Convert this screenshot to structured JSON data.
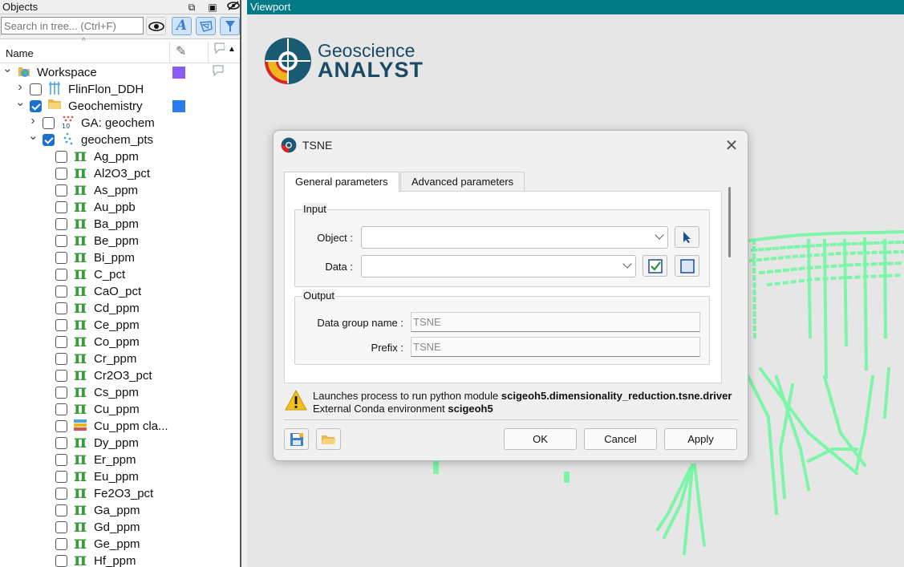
{
  "objects_panel": {
    "title": "Objects",
    "search_placeholder": "Search in tree... (Ctrl+F)",
    "column_name": "Name",
    "tree": [
      {
        "label": "Workspace",
        "level": 0,
        "expanded": true,
        "checkbox": false,
        "icon": "workspace-icon",
        "swatch": "#8a5cf6"
      },
      {
        "label": "FlinFlon_DDH",
        "level": 1,
        "expanded": false,
        "checkbox": true,
        "checked": false,
        "icon": "drillhole-icon"
      },
      {
        "label": "Geochemistry",
        "level": 1,
        "expanded": true,
        "checkbox": true,
        "checked": true,
        "icon": "folder-icon",
        "swatch": "#2b7bf0"
      },
      {
        "label": "GA: geochem",
        "level": 2,
        "expanded": false,
        "checkbox": true,
        "checked": false,
        "icon": "geochem-icon"
      },
      {
        "label": "geochem_pts",
        "level": 2,
        "expanded": true,
        "checkbox": true,
        "checked": true,
        "icon": "points-icon"
      },
      {
        "label": "Ag_ppm",
        "level": 3,
        "icon": "pi-icon"
      },
      {
        "label": "Al2O3_pct",
        "level": 3,
        "icon": "pi-icon"
      },
      {
        "label": "As_ppm",
        "level": 3,
        "icon": "pi-icon"
      },
      {
        "label": "Au_ppb",
        "level": 3,
        "icon": "pi-icon"
      },
      {
        "label": "Ba_ppm",
        "level": 3,
        "icon": "pi-icon"
      },
      {
        "label": "Be_ppm",
        "level": 3,
        "icon": "pi-icon"
      },
      {
        "label": "Bi_ppm",
        "level": 3,
        "icon": "pi-icon"
      },
      {
        "label": "C_pct",
        "level": 3,
        "icon": "pi-icon"
      },
      {
        "label": "CaO_pct",
        "level": 3,
        "icon": "pi-icon"
      },
      {
        "label": "Cd_ppm",
        "level": 3,
        "icon": "pi-icon"
      },
      {
        "label": "Ce_ppm",
        "level": 3,
        "icon": "pi-icon"
      },
      {
        "label": "Co_ppm",
        "level": 3,
        "icon": "pi-icon"
      },
      {
        "label": "Cr_ppm",
        "level": 3,
        "icon": "pi-icon"
      },
      {
        "label": "Cr2O3_pct",
        "level": 3,
        "icon": "pi-icon"
      },
      {
        "label": "Cs_ppm",
        "level": 3,
        "icon": "pi-icon"
      },
      {
        "label": "Cu_ppm",
        "level": 3,
        "icon": "pi-icon"
      },
      {
        "label": "Cu_ppm cla...",
        "level": 3,
        "icon": "classification-icon"
      },
      {
        "label": "Dy_ppm",
        "level": 3,
        "icon": "pi-icon"
      },
      {
        "label": "Er_ppm",
        "level": 3,
        "icon": "pi-icon"
      },
      {
        "label": "Eu_ppm",
        "level": 3,
        "icon": "pi-icon"
      },
      {
        "label": "Fe2O3_pct",
        "level": 3,
        "icon": "pi-icon"
      },
      {
        "label": "Ga_ppm",
        "level": 3,
        "icon": "pi-icon"
      },
      {
        "label": "Gd_ppm",
        "level": 3,
        "icon": "pi-icon"
      },
      {
        "label": "Ge_ppm",
        "level": 3,
        "icon": "pi-icon"
      },
      {
        "label": "Hf_ppm",
        "level": 3,
        "icon": "pi-icon"
      }
    ]
  },
  "viewport": {
    "title": "Viewport",
    "logo_line1": "Geoscience",
    "logo_line2": "ANALYST",
    "pointcloud_color": "#7df5a8"
  },
  "dialog": {
    "title": "TSNE",
    "tabs": [
      "General parameters",
      "Advanced parameters"
    ],
    "input_group": "Input",
    "object_label": "Object :",
    "data_label": "Data :",
    "output_group": "Output",
    "data_group_label": "Data group name :",
    "data_group_value": "TSNE",
    "prefix_label": "Prefix :",
    "prefix_value": "TSNE",
    "info_line1_prefix": "Launches process to run python module ",
    "info_line1_module": "scigeoh5.dimensionality_reduction.tsne.driver",
    "info_line2_prefix": "External Conda environment ",
    "info_line2_env": "scigeoh5",
    "ok": "OK",
    "cancel": "Cancel",
    "apply": "Apply"
  },
  "colors": {
    "viewport_title_bar": "#007a87",
    "accent_blue": "#1f6fd1",
    "pi_green": "#3c9a3c"
  }
}
